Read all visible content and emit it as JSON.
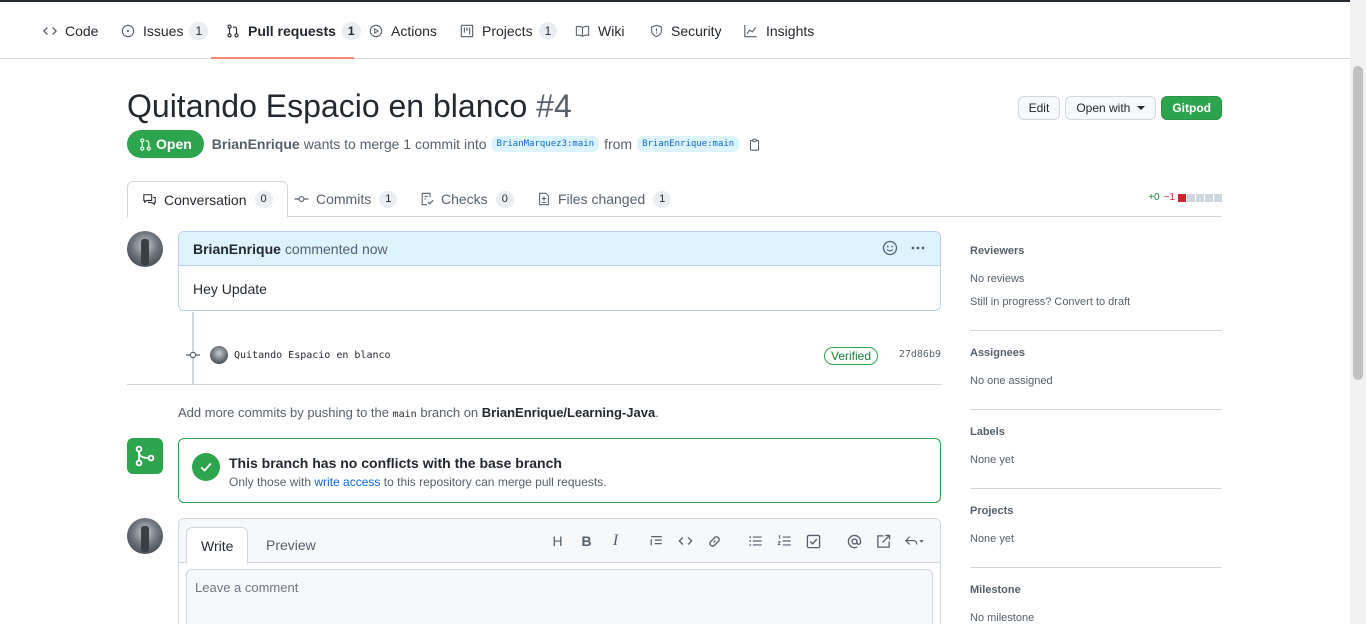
{
  "nav": {
    "items": [
      {
        "label": "Code",
        "count": null,
        "icon": "code-icon"
      },
      {
        "label": "Issues",
        "count": "1",
        "icon": "issue-icon"
      },
      {
        "label": "Pull requests",
        "count": "1",
        "icon": "pull-request-icon"
      },
      {
        "label": "Actions",
        "count": null,
        "icon": "play-icon"
      },
      {
        "label": "Projects",
        "count": "1",
        "icon": "project-icon"
      },
      {
        "label": "Wiki",
        "count": null,
        "icon": "book-icon"
      },
      {
        "label": "Security",
        "count": null,
        "icon": "shield-icon"
      },
      {
        "label": "Insights",
        "count": null,
        "icon": "graph-icon"
      }
    ]
  },
  "pr": {
    "title": "Quitando Espacio en blanco",
    "number": "#4",
    "state": "Open",
    "author": "BrianEnrique",
    "merge_text": "wants to merge 1 commit into",
    "base_branch": "BrianMarquez3:main",
    "from_text": "from",
    "head_branch": "BrianEnrique:main"
  },
  "header_actions": {
    "edit": "Edit",
    "open_with": "Open with",
    "gitpod": "Gitpod"
  },
  "tabs": [
    {
      "label": "Conversation",
      "count": "0"
    },
    {
      "label": "Commits",
      "count": "1"
    },
    {
      "label": "Checks",
      "count": "0"
    },
    {
      "label": "Files changed",
      "count": "1"
    }
  ],
  "diffstat": {
    "additions": "+0",
    "deletions": "−1",
    "add_color": "#1a7f37",
    "del_color": "#cf222e"
  },
  "comment": {
    "author": "BrianEnrique",
    "action": "commented now",
    "body": "Hey Update"
  },
  "commit": {
    "message": "Quitando Espacio en blanco",
    "verified": "Verified",
    "sha": "27d86b9"
  },
  "push_note": {
    "prefix": "Add more commits by pushing to the",
    "branch": "main",
    "middle": "branch on",
    "repo": "BrianEnrique/Learning-Java",
    "suffix": "."
  },
  "merge": {
    "title": "This branch has no conflicts with the base branch",
    "sub_prefix": "Only those with",
    "sub_link": "write access",
    "sub_suffix": "to this repository can merge pull requests."
  },
  "new_comment": {
    "write_tab": "Write",
    "preview_tab": "Preview",
    "placeholder": "Leave a comment"
  },
  "sidebar": {
    "reviewers": {
      "title": "Reviewers",
      "lines": [
        "No reviews",
        "Still in progress? Convert to draft"
      ]
    },
    "assignees": {
      "title": "Assignees",
      "lines": [
        "No one assigned"
      ]
    },
    "labels": {
      "title": "Labels",
      "lines": [
        "None yet"
      ]
    },
    "projects": {
      "title": "Projects",
      "lines": [
        "None yet"
      ]
    },
    "milestone": {
      "title": "Milestone",
      "lines": [
        "No milestone"
      ]
    }
  },
  "colors": {
    "accent_green": "#2da44e",
    "link_blue": "#0969da",
    "tab_underline": "#fd8c73"
  }
}
